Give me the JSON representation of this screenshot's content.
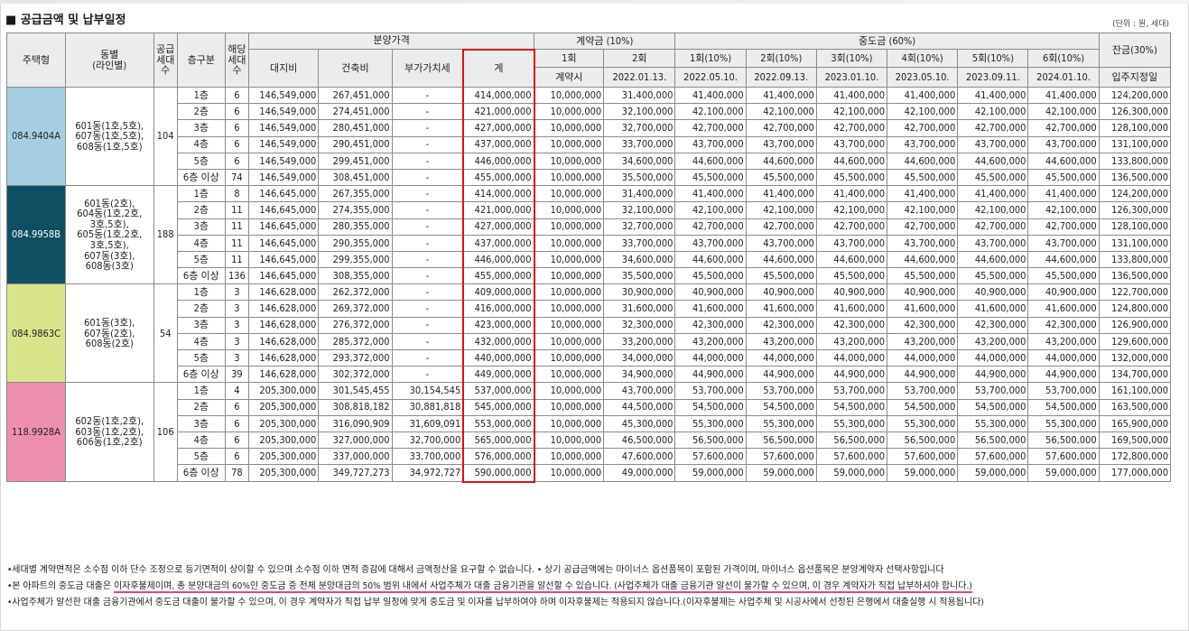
{
  "title": "■ 공급금액 및 납부일정",
  "unit": "(단위 : 원, 세대)",
  "headers": {
    "type": "주택형",
    "dong": "동별\n(라인별)",
    "supply": "공급\n세대\n수",
    "floor": "층구분",
    "units": "해당\n세대\n수",
    "price": "분양가격",
    "land": "대지비",
    "build": "건축비",
    "vat": "부가가치세",
    "total": "계",
    "contract": "계약금 (10%)",
    "c1": "1회",
    "c2": "2회",
    "c1d": "계약시",
    "c2d": "2022.01.13.",
    "middle": "중도금 (60%)",
    "m": [
      "1회(10%)",
      "2회(10%)",
      "3회(10%)",
      "4회(10%)",
      "5회(10%)",
      "6회(10%)"
    ],
    "md": [
      "2022.05.10.",
      "2022.09.13.",
      "2023.01.10.",
      "2023.05.10.",
      "2023.09.11.",
      "2024.01.10."
    ],
    "balance": "잔금(30%)",
    "balance_d": "입주지정일"
  },
  "groups": [
    {
      "type": "084.9404A",
      "color": "#a5cfe0",
      "dong": "601동(1호,5호),\n607동(1호,5호),\n608동(1호,5호)",
      "supply": "104",
      "rows": [
        [
          "1층",
          "6",
          "146,549,000",
          "267,451,000",
          "-",
          "414,000,000",
          "10,000,000",
          "31,400,000",
          "41,400,000",
          "41,400,000",
          "41,400,000",
          "41,400,000",
          "41,400,000",
          "41,400,000",
          "124,200,000"
        ],
        [
          "2층",
          "6",
          "146,549,000",
          "274,451,000",
          "-",
          "421,000,000",
          "10,000,000",
          "32,100,000",
          "42,100,000",
          "42,100,000",
          "42,100,000",
          "42,100,000",
          "42,100,000",
          "42,100,000",
          "126,300,000"
        ],
        [
          "3층",
          "6",
          "146,549,000",
          "280,451,000",
          "-",
          "427,000,000",
          "10,000,000",
          "32,700,000",
          "42,700,000",
          "42,700,000",
          "42,700,000",
          "42,700,000",
          "42,700,000",
          "42,700,000",
          "128,100,000"
        ],
        [
          "4층",
          "6",
          "146,549,000",
          "290,451,000",
          "-",
          "437,000,000",
          "10,000,000",
          "33,700,000",
          "43,700,000",
          "43,700,000",
          "43,700,000",
          "43,700,000",
          "43,700,000",
          "43,700,000",
          "131,100,000"
        ],
        [
          "5층",
          "6",
          "146,549,000",
          "299,451,000",
          "-",
          "446,000,000",
          "10,000,000",
          "34,600,000",
          "44,600,000",
          "44,600,000",
          "44,600,000",
          "44,600,000",
          "44,600,000",
          "44,600,000",
          "133,800,000"
        ],
        [
          "6층 이상",
          "74",
          "146,549,000",
          "308,451,000",
          "-",
          "455,000,000",
          "10,000,000",
          "35,500,000",
          "45,500,000",
          "45,500,000",
          "45,500,000",
          "45,500,000",
          "45,500,000",
          "45,500,000",
          "136,500,000"
        ]
      ]
    },
    {
      "type": "084.9958B",
      "color": "#0f4f64",
      "dong": "601동(2호),\n604동(1호,2호,\n3호,5호),\n605동(1호,2호,\n3호,5호),\n607동(3호),\n608동(3호)",
      "supply": "188",
      "rows": [
        [
          "1층",
          "8",
          "146,645,000",
          "267,355,000",
          "-",
          "414,000,000",
          "10,000,000",
          "31,400,000",
          "41,400,000",
          "41,400,000",
          "41,400,000",
          "41,400,000",
          "41,400,000",
          "41,400,000",
          "124,200,000"
        ],
        [
          "2층",
          "11",
          "146,645,000",
          "274,355,000",
          "-",
          "421,000,000",
          "10,000,000",
          "32,100,000",
          "42,100,000",
          "42,100,000",
          "42,100,000",
          "42,100,000",
          "42,100,000",
          "42,100,000",
          "126,300,000"
        ],
        [
          "3층",
          "11",
          "146,645,000",
          "280,355,000",
          "-",
          "427,000,000",
          "10,000,000",
          "32,700,000",
          "42,700,000",
          "42,700,000",
          "42,700,000",
          "42,700,000",
          "42,700,000",
          "42,700,000",
          "128,100,000"
        ],
        [
          "4층",
          "11",
          "146,645,000",
          "290,355,000",
          "-",
          "437,000,000",
          "10,000,000",
          "33,700,000",
          "43,700,000",
          "43,700,000",
          "43,700,000",
          "43,700,000",
          "43,700,000",
          "43,700,000",
          "131,100,000"
        ],
        [
          "5층",
          "11",
          "146,645,000",
          "299,355,000",
          "-",
          "446,000,000",
          "10,000,000",
          "34,600,000",
          "44,600,000",
          "44,600,000",
          "44,600,000",
          "44,600,000",
          "44,600,000",
          "44,600,000",
          "133,800,000"
        ],
        [
          "6층 이상",
          "136",
          "146,645,000",
          "308,355,000",
          "-",
          "455,000,000",
          "10,000,000",
          "35,500,000",
          "45,500,000",
          "45,500,000",
          "45,500,000",
          "45,500,000",
          "45,500,000",
          "45,500,000",
          "136,500,000"
        ]
      ]
    },
    {
      "type": "084.9863C",
      "color": "#d9e38b",
      "dong": "601동(3호),\n607동(2호),\n608동(2호)",
      "supply": "54",
      "rows": [
        [
          "1층",
          "3",
          "146,628,000",
          "262,372,000",
          "-",
          "409,000,000",
          "10,000,000",
          "30,900,000",
          "40,900,000",
          "40,900,000",
          "40,900,000",
          "40,900,000",
          "40,900,000",
          "40,900,000",
          "122,700,000"
        ],
        [
          "2층",
          "3",
          "146,628,000",
          "269,372,000",
          "-",
          "416,000,000",
          "10,000,000",
          "31,600,000",
          "41,600,000",
          "41,600,000",
          "41,600,000",
          "41,600,000",
          "41,600,000",
          "41,600,000",
          "124,800,000"
        ],
        [
          "3층",
          "3",
          "146,628,000",
          "276,372,000",
          "-",
          "423,000,000",
          "10,000,000",
          "32,300,000",
          "42,300,000",
          "42,300,000",
          "42,300,000",
          "42,300,000",
          "42,300,000",
          "42,300,000",
          "126,900,000"
        ],
        [
          "4층",
          "3",
          "146,628,000",
          "285,372,000",
          "-",
          "432,000,000",
          "10,000,000",
          "33,200,000",
          "43,200,000",
          "43,200,000",
          "43,200,000",
          "43,200,000",
          "43,200,000",
          "43,200,000",
          "129,600,000"
        ],
        [
          "5층",
          "3",
          "146,628,000",
          "293,372,000",
          "-",
          "440,000,000",
          "10,000,000",
          "34,000,000",
          "44,000,000",
          "44,000,000",
          "44,000,000",
          "44,000,000",
          "44,000,000",
          "44,000,000",
          "132,000,000"
        ],
        [
          "6층 이상",
          "39",
          "146,628,000",
          "302,372,000",
          "-",
          "449,000,000",
          "10,000,000",
          "34,900,000",
          "44,900,000",
          "44,900,000",
          "44,900,000",
          "44,900,000",
          "44,900,000",
          "44,900,000",
          "134,700,000"
        ]
      ]
    },
    {
      "type": "118.9928A",
      "color": "#ec8fb1",
      "dong": "602동(1호,2호),\n603동(1호,2호),\n606동(1호,2호)",
      "supply": "106",
      "rows": [
        [
          "1층",
          "4",
          "205,300,000",
          "301,545,455",
          "30,154,545",
          "537,000,000",
          "10,000,000",
          "43,700,000",
          "53,700,000",
          "53,700,000",
          "53,700,000",
          "53,700,000",
          "53,700,000",
          "53,700,000",
          "161,100,000"
        ],
        [
          "2층",
          "6",
          "205,300,000",
          "308,818,182",
          "30,881,818",
          "545,000,000",
          "10,000,000",
          "44,500,000",
          "54,500,000",
          "54,500,000",
          "54,500,000",
          "54,500,000",
          "54,500,000",
          "54,500,000",
          "163,500,000"
        ],
        [
          "3층",
          "6",
          "205,300,000",
          "316,090,909",
          "31,609,091",
          "553,000,000",
          "10,000,000",
          "45,300,000",
          "55,300,000",
          "55,300,000",
          "55,300,000",
          "55,300,000",
          "55,300,000",
          "55,300,000",
          "165,900,000"
        ],
        [
          "4층",
          "6",
          "205,300,000",
          "327,000,000",
          "32,700,000",
          "565,000,000",
          "10,000,000",
          "46,500,000",
          "56,500,000",
          "56,500,000",
          "56,500,000",
          "56,500,000",
          "56,500,000",
          "56,500,000",
          "169,500,000"
        ],
        [
          "5층",
          "6",
          "205,300,000",
          "337,000,000",
          "33,700,000",
          "576,000,000",
          "10,000,000",
          "47,600,000",
          "57,600,000",
          "57,600,000",
          "57,600,000",
          "57,600,000",
          "57,600,000",
          "57,600,000",
          "172,800,000"
        ],
        [
          "6층 이상",
          "78",
          "205,300,000",
          "349,727,273",
          "34,972,727",
          "590,000,000",
          "10,000,000",
          "49,000,000",
          "59,000,000",
          "59,000,000",
          "59,000,000",
          "59,000,000",
          "59,000,000",
          "59,000,000",
          "177,000,000"
        ]
      ]
    }
  ],
  "notes": {
    "n1": "•세대별 계약면적은 소수점 이하 단수 조정으로 등기면적이 상이할 수 있으며 소수점 이하 면적 증감에 대해서 금액정산을 요구할 수 없습니다.   • 상기 공급금액에는 마이너스 옵션품목이 포함된 가격이며, 마이너스 옵션품목은 분양계약자 선택사항입니다",
    "n2a": "•본 아파트의 중도금 대출은 ",
    "n2b": "이자후불제이며, 총 분양대금의 60%인 중도금 중 전체 분양대금의 50% 범위 내에서 사업주체가 대출 금융기관을 알선할 수 있습니다. (사업주체가 대출 금융기관 알선이 불가할 수 있으며, 이 경우 계약자가 직접 납부하셔야 합니다.)",
    "n3": "•사업주체가 알선한 대출 금융기관에서 중도금 대출이 불가할 수 있으며, 이 경우 계약자가 직접 납부 일정에 맞게 중도금 및 이자를 납부하여야 하며 이자후불제는 적용되지 않습니다.(이자후불제는 사업주체 및 시공사에서 선정된 은행에서 대출실행 시 적용됩니다)"
  }
}
